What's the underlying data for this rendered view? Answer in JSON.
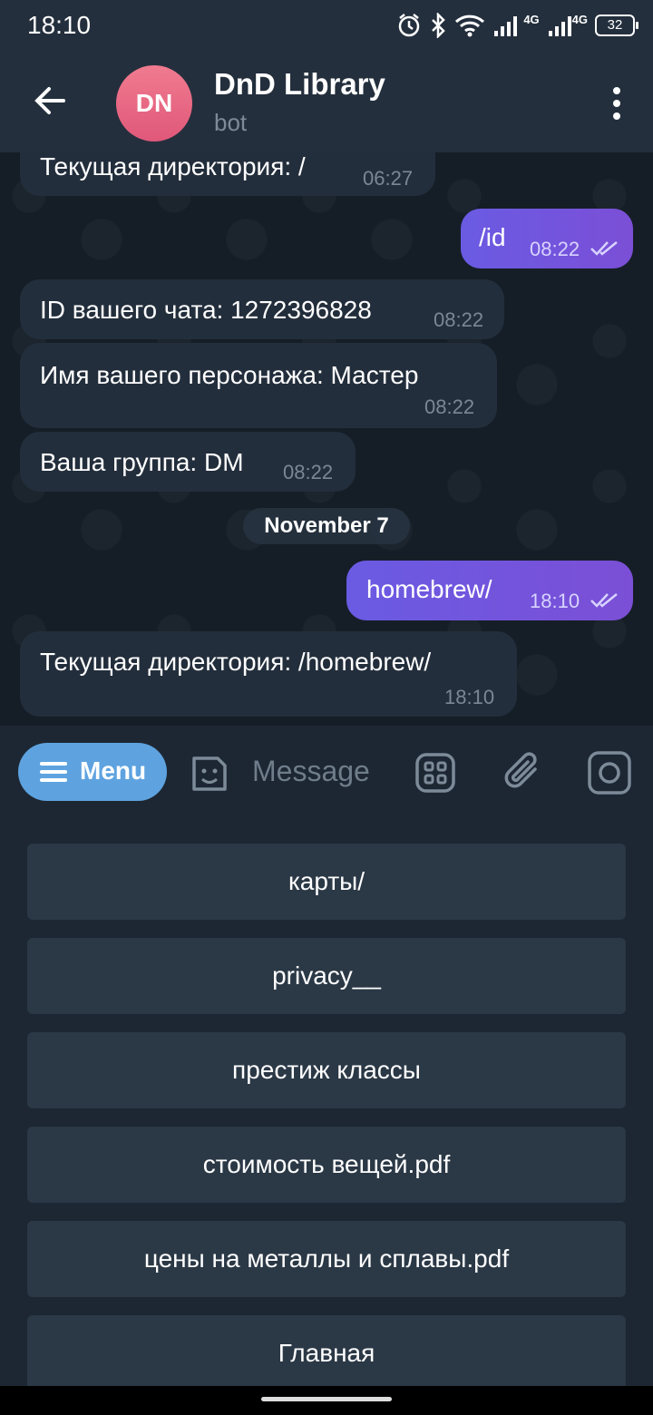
{
  "status_bar": {
    "time": "18:10",
    "battery": "32",
    "network_1": "4G",
    "network_2": "4G"
  },
  "header": {
    "avatar_initials": "DN",
    "title": "DnD Library",
    "subtitle": "bot"
  },
  "messages": [
    {
      "direction": "in",
      "text": "Текущая директория: /",
      "time": "06:27"
    },
    {
      "direction": "out",
      "text": "/id",
      "time": "08:22",
      "read": true
    },
    {
      "direction": "in",
      "text": "ID вашего чата: 1272396828",
      "time": "08:22"
    },
    {
      "direction": "in",
      "text": "Имя вашего персонажа: Мастер",
      "time": "08:22"
    },
    {
      "direction": "in",
      "text": "Ваша группа: DM",
      "time": "08:22"
    },
    {
      "direction": "out",
      "text": "homebrew/",
      "time": "18:10",
      "read": true
    },
    {
      "direction": "in",
      "text": "Текущая директория: /homebrew/",
      "time": "18:10"
    }
  ],
  "date_separator": "November 7",
  "input_bar": {
    "menu_label": "Menu",
    "placeholder": "Message"
  },
  "keyboard": {
    "buttons": [
      "карты/",
      "privacy__",
      "престиж классы",
      "стоимость вещей.pdf",
      "цены на металлы и сплавы.pdf",
      "Главная"
    ]
  },
  "colors": {
    "accent": "#5ea3e0",
    "outgoing": "#6a5be3",
    "incoming": "#232e3c",
    "avatar": "#e8647f"
  }
}
